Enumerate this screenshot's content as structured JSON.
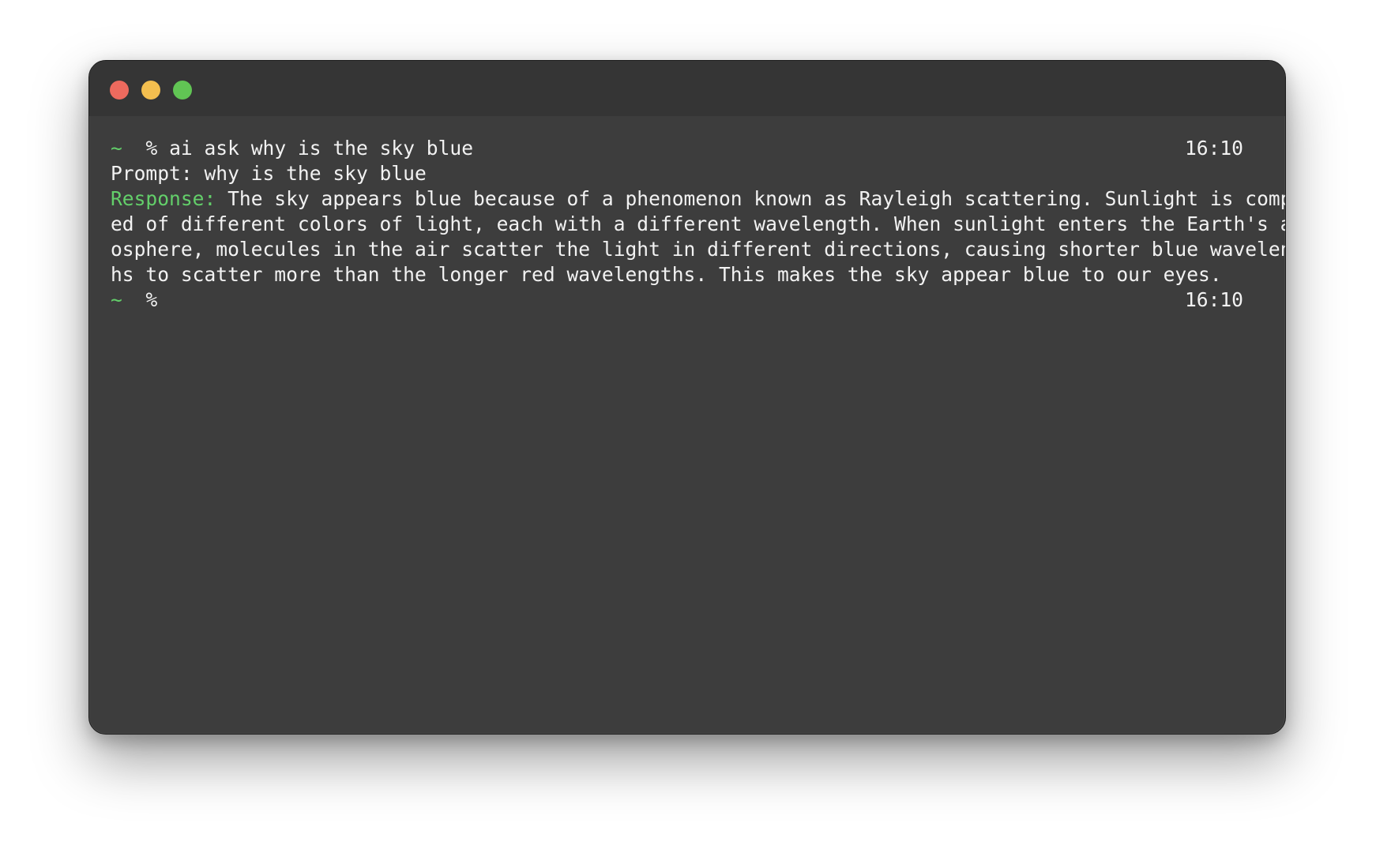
{
  "window": {
    "controls": {
      "close_color": "#ed6a5e",
      "minimize_color": "#f4bf4f",
      "zoom_color": "#61c554"
    }
  },
  "terminal": {
    "prompt_symbol": "~",
    "prompt_char": "%",
    "command": "ai ask why is the sky blue",
    "command_time": "16:10",
    "prompt_line": "Prompt: why is the sky blue",
    "response_label": "Response:",
    "response_lines": [
      "The sky appears blue because of a phenomenon known as Rayleigh scattering. Sunlight is compos",
      "ed of different colors of light, each with a different wavelength. When sunlight enters the Earth's atm",
      "osphere, molecules in the air scatter the light in different directions, causing shorter blue wavelengt",
      "hs to scatter more than the longer red wavelengths. This makes the sky appear blue to our eyes."
    ],
    "final_time": "16:10",
    "accent_color": "#63cf6a",
    "background_color": "#3d3d3d"
  }
}
